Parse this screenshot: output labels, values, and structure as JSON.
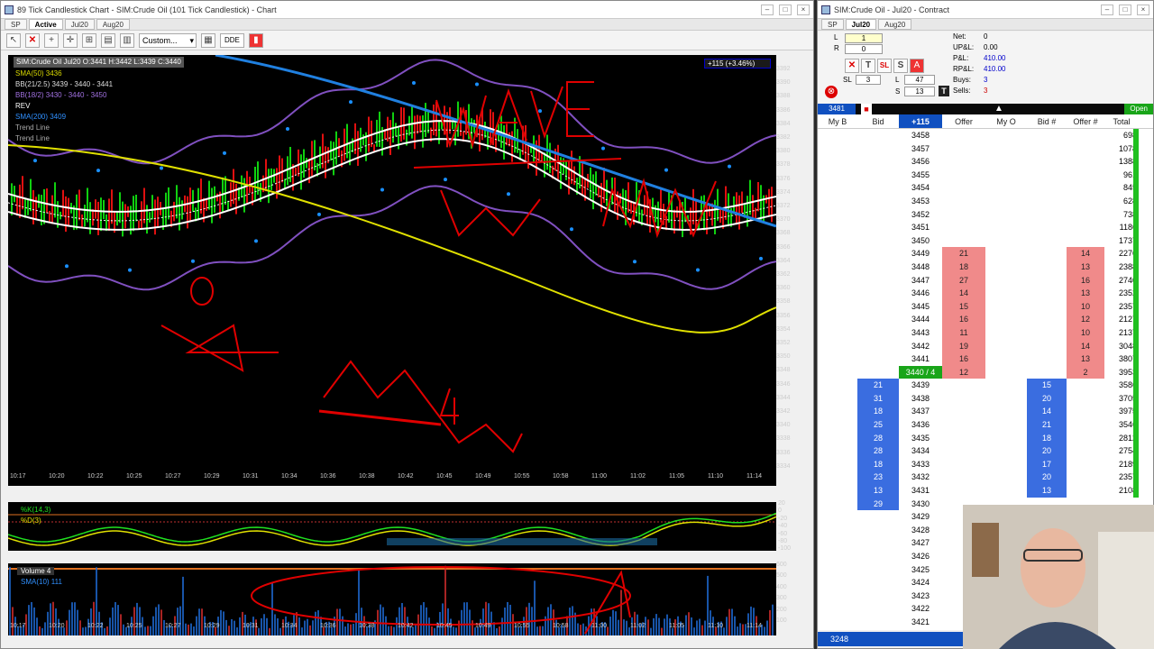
{
  "chart_window": {
    "title": "89 Tick Candlestick Chart - SIM:Crude Oil (101 Tick Candlestick) - Chart",
    "tabs": [
      "SP",
      "Active",
      "Jul20",
      "Aug20"
    ],
    "toolbar": {
      "select_value": "Custom...",
      "dde_label": "DDE"
    },
    "legend": {
      "header": "SIM:Crude Oil Jul20 O:3441 H:3442 L:3439 C:3440",
      "items": [
        "SMA(50) 3436",
        "BB(21/2.5) 3439 - 3440 - 3441",
        "BB(18/2) 3430 - 3440 - 3450",
        "REV",
        "SMA(200) 3409",
        "Trend Line",
        "Trend Line"
      ]
    },
    "change_tag": "+115 (+3.46%)",
    "price_axis": [
      "3392",
      "3390",
      "3388",
      "3386",
      "3384",
      "3382",
      "3380",
      "3378",
      "3376",
      "3374",
      "3372",
      "3370",
      "3368",
      "3366",
      "3364",
      "3362",
      "3360",
      "3358",
      "3356",
      "3354",
      "3352",
      "3350",
      "3348",
      "3346",
      "3344",
      "3342",
      "3340",
      "3338",
      "3336",
      "3334"
    ],
    "time_axis": [
      "10:17",
      "10:20",
      "10:22",
      "10:25",
      "10:27",
      "10:29",
      "10:31",
      "10:34",
      "10:36",
      "10:38",
      "10:42",
      "10:45",
      "10:49",
      "10:55",
      "10:58",
      "11:00",
      "11:02",
      "11:05",
      "11:10",
      "11:14"
    ],
    "osc_axis": [
      "20",
      "0",
      "-20",
      "-40",
      "-60",
      "-80",
      "-100"
    ],
    "osc_legend": [
      "%K(14,3)",
      "%D(3)"
    ],
    "vol_axis": [
      "600",
      "500",
      "400",
      "300",
      "200",
      "100"
    ],
    "vol_legend": [
      "Volume 4",
      "SMA(10) 111"
    ],
    "annotations": [
      "WAVE",
      "A",
      "Mum",
      "D",
      "A",
      "4"
    ]
  },
  "dom_window": {
    "title": "SIM:Crude Oil - Jul20 - Contract",
    "tabs": [
      "SP",
      "Jul20",
      "Aug20"
    ],
    "qty": {
      "sl_label": "SL",
      "sl_value": "3",
      "l_label": "L",
      "l_value": "47",
      "s_label": "S",
      "s_value": "13",
      "top_l": "1",
      "top_r": "0"
    },
    "stats": {
      "net_label": "Net:",
      "net": "0",
      "upl_label": "UP&L:",
      "upl": "0.00",
      "pl_label": "P&L:",
      "pl": "410.00",
      "rpl_label": "RP&L:",
      "rpl": "410.00",
      "buys_label": "Buys:",
      "buys": "3",
      "sells_label": "Sells:",
      "sells": "3"
    },
    "header_bar": {
      "left_value": "3481",
      "open_label": "Open"
    },
    "columns": [
      "My B",
      "Bid",
      "+115",
      "Offer",
      "My O",
      "Bid #",
      "Offer #",
      "Total"
    ],
    "rows": [
      {
        "price": "3458",
        "bid": "",
        "offer": "",
        "bidn": "",
        "offn": "",
        "total": "698"
      },
      {
        "price": "3457",
        "bid": "",
        "offer": "",
        "bidn": "",
        "offn": "",
        "total": "1078"
      },
      {
        "price": "3456",
        "bid": "",
        "offer": "",
        "bidn": "",
        "offn": "",
        "total": "1388"
      },
      {
        "price": "3455",
        "bid": "",
        "offer": "",
        "bidn": "",
        "offn": "",
        "total": "961"
      },
      {
        "price": "3454",
        "bid": "",
        "offer": "",
        "bidn": "",
        "offn": "",
        "total": "845"
      },
      {
        "price": "3453",
        "bid": "",
        "offer": "",
        "bidn": "",
        "offn": "",
        "total": "628"
      },
      {
        "price": "3452",
        "bid": "",
        "offer": "",
        "bidn": "",
        "offn": "",
        "total": "738"
      },
      {
        "price": "3451",
        "bid": "",
        "offer": "",
        "bidn": "",
        "offn": "",
        "total": "1186"
      },
      {
        "price": "3450",
        "bid": "",
        "offer": "",
        "bidn": "",
        "offn": "",
        "total": "1737"
      },
      {
        "price": "3449",
        "bid": "",
        "offer": "21",
        "bidn": "",
        "offn": "14",
        "total": "2276"
      },
      {
        "price": "3448",
        "bid": "",
        "offer": "18",
        "bidn": "",
        "offn": "13",
        "total": "2388"
      },
      {
        "price": "3447",
        "bid": "",
        "offer": "27",
        "bidn": "",
        "offn": "16",
        "total": "2740"
      },
      {
        "price": "3446",
        "bid": "",
        "offer": "14",
        "bidn": "",
        "offn": "13",
        "total": "2352"
      },
      {
        "price": "3445",
        "bid": "",
        "offer": "15",
        "bidn": "",
        "offn": "10",
        "total": "2357"
      },
      {
        "price": "3444",
        "bid": "",
        "offer": "16",
        "bidn": "",
        "offn": "12",
        "total": "2127"
      },
      {
        "price": "3443",
        "bid": "",
        "offer": "11",
        "bidn": "",
        "offn": "10",
        "total": "2137"
      },
      {
        "price": "3442",
        "bid": "",
        "offer": "19",
        "bidn": "",
        "offn": "14",
        "total": "3048"
      },
      {
        "price": "3441",
        "bid": "",
        "offer": "16",
        "bidn": "",
        "offn": "13",
        "total": "3807"
      },
      {
        "price": "3440 / 4",
        "bid": "",
        "offer": "12",
        "bidn": "",
        "offn": "2",
        "total": "3953",
        "current": true
      },
      {
        "price": "3439",
        "bid": "21",
        "offer": "",
        "bidn": "15",
        "offn": "",
        "total": "3586"
      },
      {
        "price": "3438",
        "bid": "31",
        "offer": "",
        "bidn": "20",
        "offn": "",
        "total": "3705"
      },
      {
        "price": "3437",
        "bid": "18",
        "offer": "",
        "bidn": "14",
        "offn": "",
        "total": "3975"
      },
      {
        "price": "3436",
        "bid": "25",
        "offer": "",
        "bidn": "21",
        "offn": "",
        "total": "3546"
      },
      {
        "price": "3435",
        "bid": "28",
        "offer": "",
        "bidn": "18",
        "offn": "",
        "total": "2812"
      },
      {
        "price": "3434",
        "bid": "28",
        "offer": "",
        "bidn": "20",
        "offn": "",
        "total": "2754"
      },
      {
        "price": "3433",
        "bid": "18",
        "offer": "",
        "bidn": "17",
        "offn": "",
        "total": "2189"
      },
      {
        "price": "3432",
        "bid": "23",
        "offer": "",
        "bidn": "20",
        "offn": "",
        "total": "2357"
      },
      {
        "price": "3431",
        "bid": "13",
        "offer": "",
        "bidn": "13",
        "offn": "",
        "total": "2108"
      },
      {
        "price": "3430",
        "bid": "29",
        "offer": "",
        "bidn": "",
        "offn": "",
        "total": ""
      },
      {
        "price": "3429",
        "bid": "",
        "offer": "",
        "bidn": "",
        "offn": "",
        "total": ""
      },
      {
        "price": "3428",
        "bid": "",
        "offer": "",
        "bidn": "",
        "offn": "",
        "total": ""
      },
      {
        "price": "3427",
        "bid": "",
        "offer": "",
        "bidn": "",
        "offn": "",
        "total": ""
      },
      {
        "price": "3426",
        "bid": "",
        "offer": "",
        "bidn": "",
        "offn": "",
        "total": ""
      },
      {
        "price": "3425",
        "bid": "",
        "offer": "",
        "bidn": "",
        "offn": "",
        "total": ""
      },
      {
        "price": "3424",
        "bid": "",
        "offer": "",
        "bidn": "",
        "offn": "",
        "total": ""
      },
      {
        "price": "3423",
        "bid": "",
        "offer": "",
        "bidn": "",
        "offn": "",
        "total": ""
      },
      {
        "price": "3422",
        "bid": "",
        "offer": "",
        "bidn": "",
        "offn": "",
        "total": ""
      },
      {
        "price": "3421",
        "bid": "",
        "offer": "",
        "bidn": "",
        "offn": "",
        "total": ""
      }
    ],
    "status_value": "3248"
  },
  "colors": {
    "bid": "#3a6de0",
    "offer": "#f08a8a",
    "current": "#19a519",
    "annotation": "#e00000"
  }
}
